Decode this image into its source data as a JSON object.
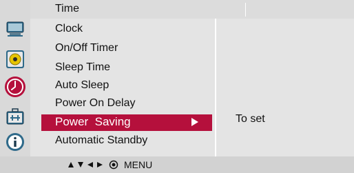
{
  "header": {
    "title": "Time"
  },
  "sidebar": {
    "items": [
      {
        "icon": "monitor-icon"
      },
      {
        "icon": "audio-icon"
      },
      {
        "icon": "clock-icon",
        "selected": true
      },
      {
        "icon": "toolbox-icon"
      },
      {
        "icon": "info-icon"
      }
    ]
  },
  "menu": {
    "items": [
      {
        "label": "Clock"
      },
      {
        "label": "On/Off Timer"
      },
      {
        "label": "Sleep Time"
      },
      {
        "label": "Auto Sleep"
      },
      {
        "label": "Power On Delay"
      },
      {
        "label": "Power  Saving",
        "selected": true
      },
      {
        "label": "Automatic Standby"
      }
    ]
  },
  "value_panel": {
    "text": "To set"
  },
  "footer": {
    "label": "MENU",
    "icons": [
      "up-triangle-icon",
      "down-triangle-icon",
      "left-triangle-icon",
      "right-triangle-icon",
      "select-circle-icon"
    ]
  },
  "colors": {
    "accent": "#b5103c",
    "panel": "#e4e4e4",
    "sidebar": "#d9d9d9"
  }
}
